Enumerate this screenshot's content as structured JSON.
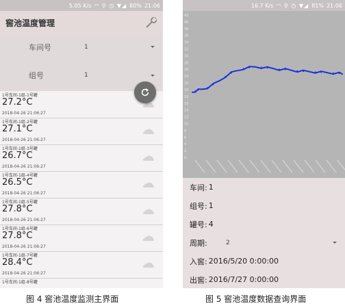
{
  "left": {
    "status": {
      "speed": "5.05 K/s",
      "battery": "80%",
      "time": "21:06"
    },
    "title": "窖池温度管理",
    "filters": [
      {
        "label": "车间号",
        "value": "1"
      },
      {
        "label": "组号",
        "value": "1"
      }
    ],
    "items": [
      {
        "name": "1号车间-1组-1号罐",
        "temp": "27.2°C",
        "time": "2018-04-26 21:06:27"
      },
      {
        "name": "1号车间-1组-2号罐",
        "temp": "27.1°C",
        "time": "2018-04-26 21:06:27"
      },
      {
        "name": "1号车间-1组-3号罐",
        "temp": "26.7°C",
        "time": "2018-04-26 21:06:27"
      },
      {
        "name": "1号车间-1组-4号罐",
        "temp": "26.5°C",
        "time": "2018-04-26 21:06:27"
      },
      {
        "name": "1号车间-1组-5号罐",
        "temp": "27.8°C",
        "time": "2018-04-26 21:06:27"
      },
      {
        "name": "1号车间-1组-6号罐",
        "temp": "27.8°C",
        "time": "2018-04-26 21:06:27"
      },
      {
        "name": "1号车间-1组-7号罐",
        "temp": "28.4°C",
        "time": "2018-04-26 21:06:27"
      },
      {
        "name": "1号车间-1组-8号罐",
        "temp": "",
        "time": ""
      }
    ],
    "caption": "图 4  窖池温度监测主界面"
  },
  "right": {
    "status": {
      "speed": "16.7 K/s",
      "battery": "81%",
      "time": "21:06"
    },
    "details": {
      "workshop": {
        "label": "车间:",
        "value": "1"
      },
      "group": {
        "label": "组号:",
        "value": "1"
      },
      "tank": {
        "label": "罐号:",
        "value": "4"
      },
      "period": {
        "label": "周期:",
        "value": "2"
      },
      "in": {
        "label": "入窖:",
        "value": "2016/5/20 0:00:00"
      },
      "out": {
        "label": "出窖:",
        "value": "2016/7/27 0:00:00"
      }
    },
    "caption": "图 5  窖池温度数据查询界面"
  },
  "chart_data": {
    "type": "line",
    "ylim": [
      0,
      42
    ],
    "yticks": [
      "0",
      "2",
      "4",
      "6",
      "8",
      "10",
      "12",
      "14",
      "16",
      "18",
      "20",
      "22",
      "24",
      "26",
      "28",
      "30",
      "32",
      "34",
      "36",
      "38",
      "40",
      "42"
    ],
    "series": [
      {
        "color": "#1a2fe0",
        "points": [
          [
            0,
            19.2
          ],
          [
            2,
            19.6
          ],
          [
            4,
            19.9
          ],
          [
            6,
            20.1
          ],
          [
            10,
            20.6
          ],
          [
            14,
            21.5
          ],
          [
            18,
            22.6
          ],
          [
            22,
            23.9
          ],
          [
            26,
            24.9
          ],
          [
            30,
            25.6
          ],
          [
            34,
            26.2
          ],
          [
            38,
            26.5
          ],
          [
            42,
            26.7
          ],
          [
            46,
            26.6
          ],
          [
            50,
            26.4
          ],
          [
            54,
            26.2
          ],
          [
            58,
            26.0
          ],
          [
            62,
            25.9
          ],
          [
            66,
            25.7
          ],
          [
            70,
            25.5
          ],
          [
            74,
            25.4
          ],
          [
            78,
            25.3
          ],
          [
            82,
            25.2
          ],
          [
            86,
            25.1
          ],
          [
            90,
            25.0
          ],
          [
            94,
            24.9
          ],
          [
            98,
            24.8
          ],
          [
            100,
            24.6
          ]
        ]
      }
    ],
    "color": "#1a2fe0",
    "grid": false
  }
}
